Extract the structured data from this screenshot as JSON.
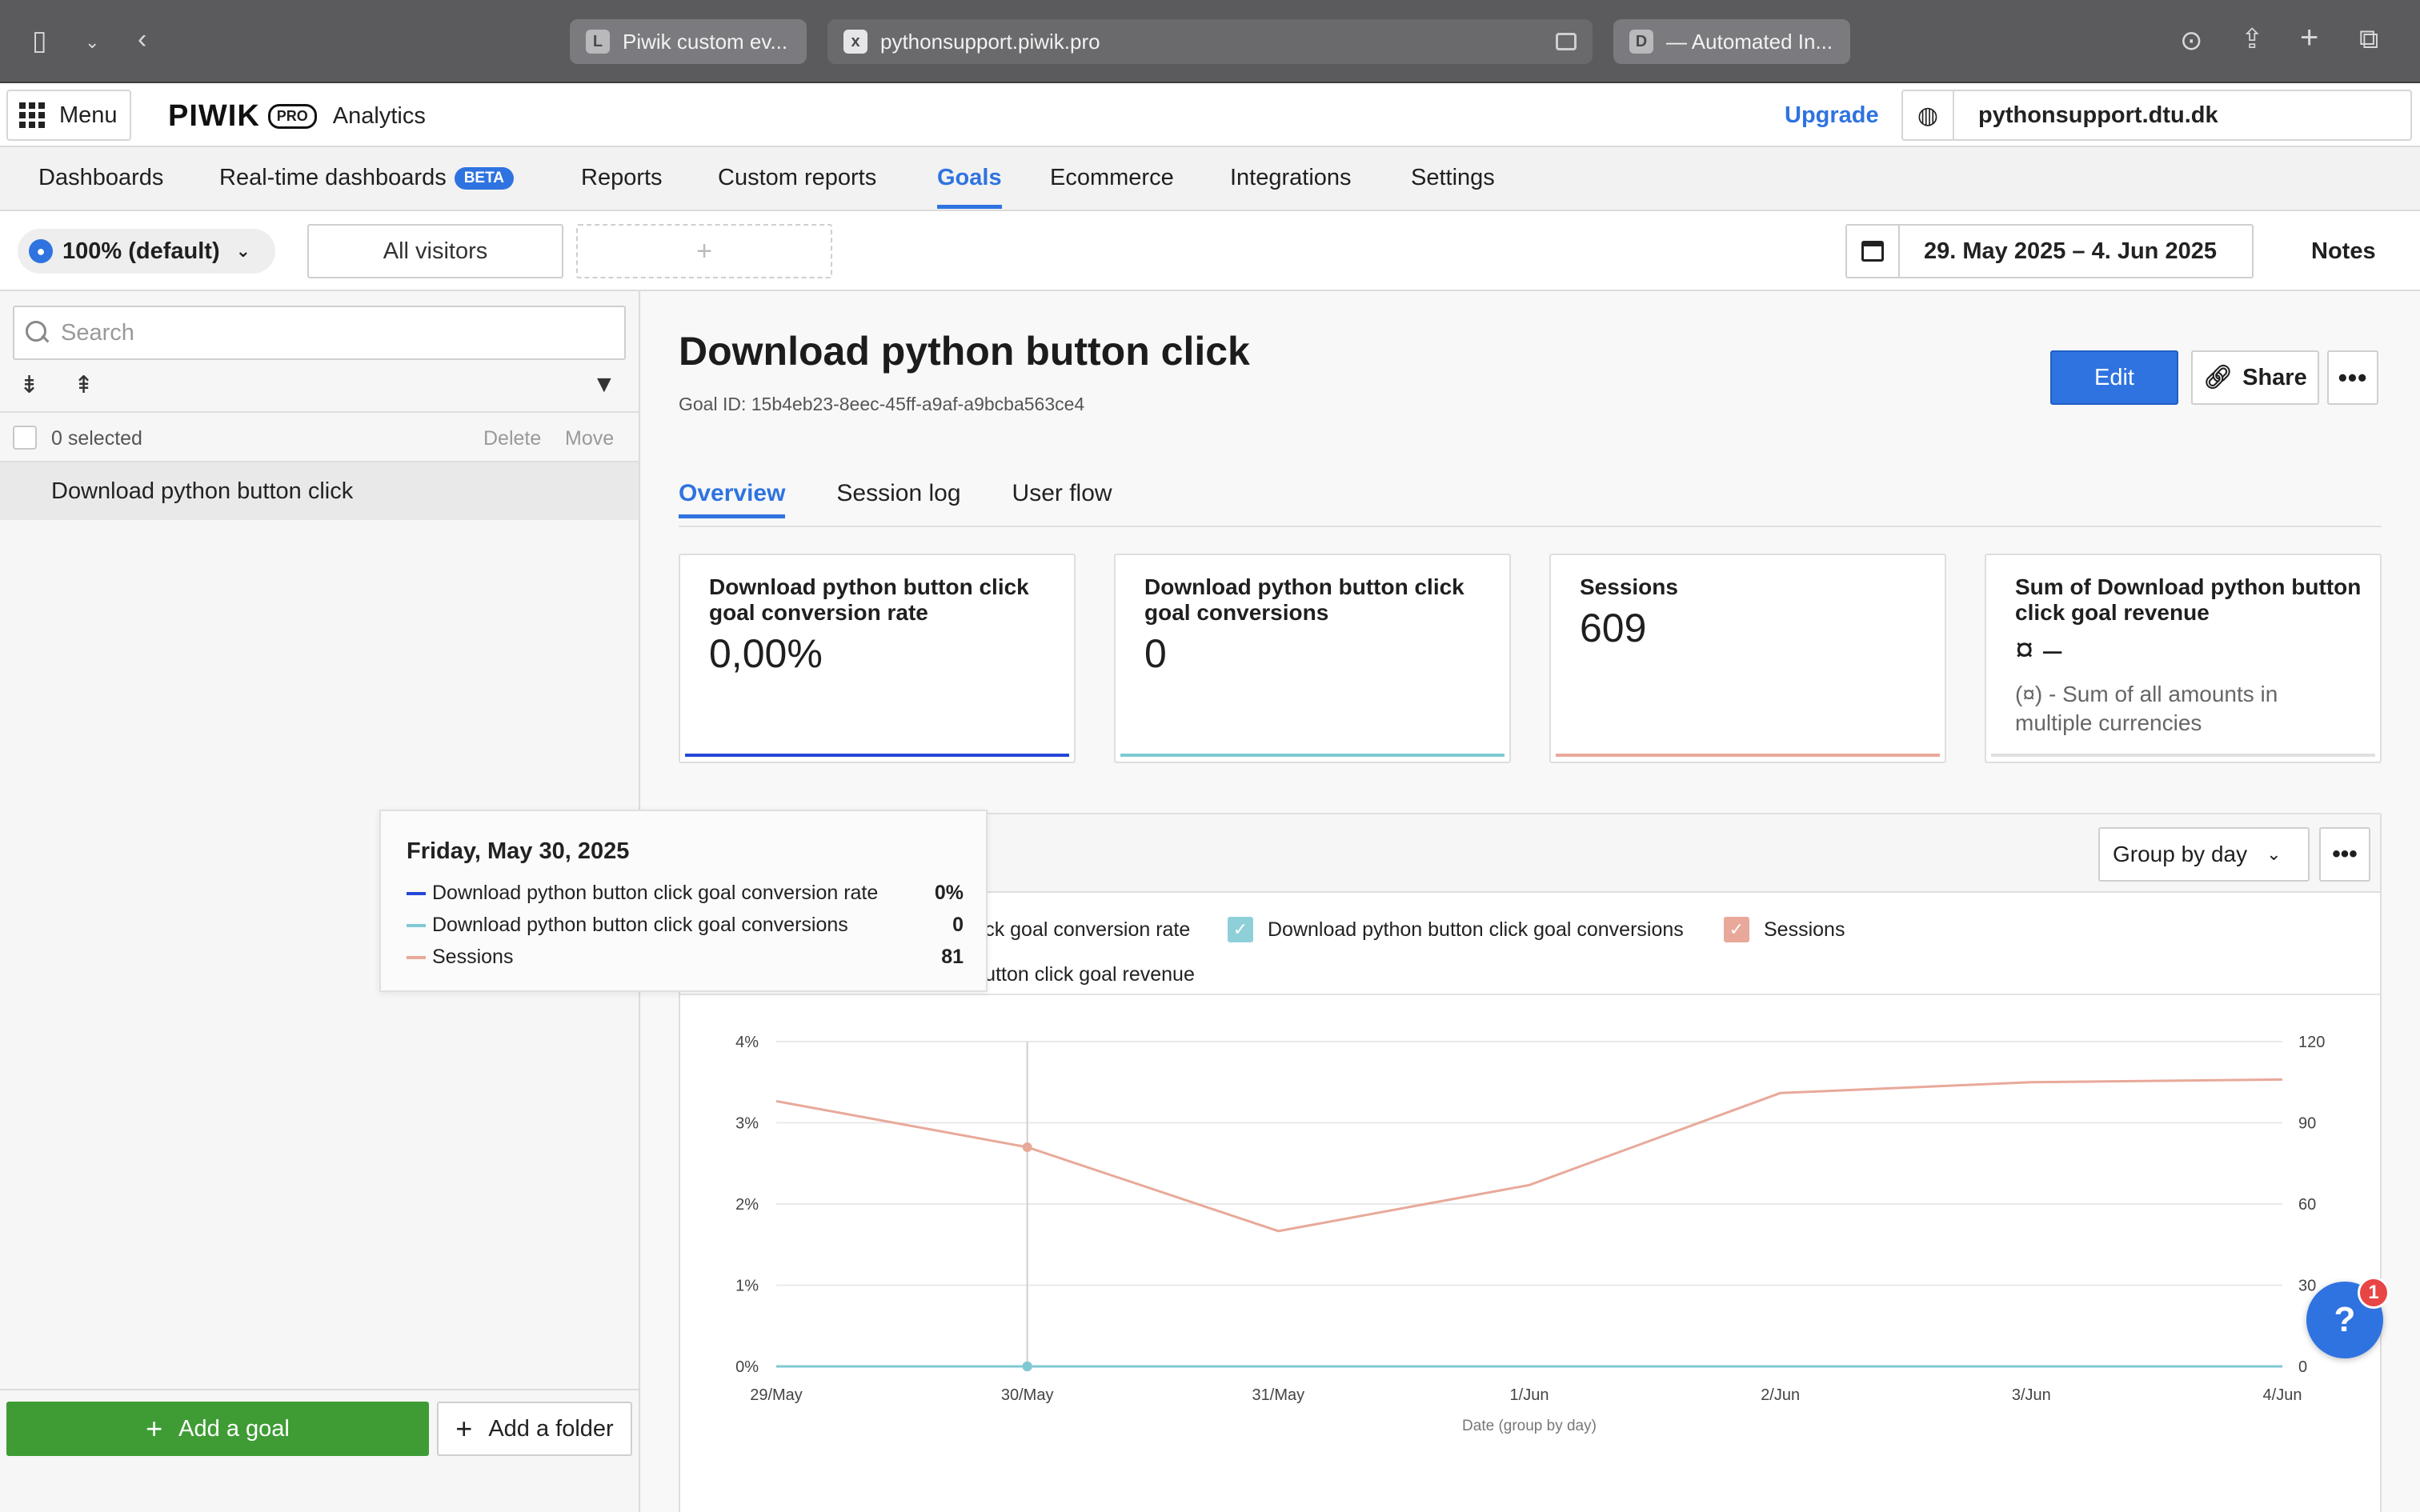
{
  "browser": {
    "tabs": [
      {
        "favicon": "L",
        "title": "Piwik custom ev..."
      },
      {
        "favicon": "x",
        "title": "pythonsupport.piwik.pro"
      },
      {
        "favicon": "D",
        "title": "— Automated In..."
      }
    ],
    "icons": [
      "sidebar-icon",
      "chevron-down-icon",
      "back-icon",
      "download-icon",
      "share-icon",
      "new-tab-icon",
      "tab-overview-icon"
    ]
  },
  "header": {
    "menu_label": "Menu",
    "logo_text": "PIWIK",
    "logo_badge": "PRO",
    "product": "Analytics",
    "upgrade_label": "Upgrade",
    "site": "pythonsupport.dtu.dk"
  },
  "nav": {
    "items": [
      {
        "label": "Dashboards"
      },
      {
        "label": "Real-time dashboards",
        "badge": "BETA"
      },
      {
        "label": "Reports"
      },
      {
        "label": "Custom reports"
      },
      {
        "label": "Goals",
        "active": true
      },
      {
        "label": "Ecommerce"
      },
      {
        "label": "Integrations"
      },
      {
        "label": "Settings"
      }
    ]
  },
  "filters": {
    "sampling": "100% (default)",
    "segment": "All visitors",
    "add_segment": "+",
    "date_range": "29. May 2025 – 4. Jun 2025",
    "notes_label": "Notes"
  },
  "sidebar": {
    "search_placeholder": "Search",
    "selected_text": "0 selected",
    "delete_label": "Delete",
    "move_label": "Move",
    "goals": [
      "Download python button click"
    ],
    "add_goal_label": "Add a goal",
    "add_folder_label": "Add a folder"
  },
  "goal": {
    "title": "Download python button click",
    "id_text": "Goal ID: 15b4eb23-8eec-45ff-a9af-a9bcba563ce4",
    "edit_label": "Edit",
    "share_label": "Share",
    "more_label": "•••",
    "tabs": [
      {
        "label": "Overview",
        "active": true
      },
      {
        "label": "Session log"
      },
      {
        "label": "User flow"
      }
    ]
  },
  "kpis": [
    {
      "label": "Download python button click goal conversion rate",
      "value": "0,00%",
      "color": "#2546d6"
    },
    {
      "label": "Download python button click goal conversions",
      "value": "0",
      "color": "#7fc9d3"
    },
    {
      "label": "Sessions",
      "value": "609",
      "color": "#e8a99a"
    },
    {
      "label": "Sum of Download python button click goal revenue",
      "value": "¤ –",
      "note": "(¤) - Sum of all amounts in multiple currencies",
      "color": "#e0e0e0"
    }
  ],
  "chart_panel": {
    "group_by_label": "Group by day",
    "more_label": "•••",
    "legend": [
      {
        "label": "Download python button click goal conversion rate",
        "checked": true,
        "color": "#2546d6"
      },
      {
        "label": "Download python button click goal conversions",
        "checked": true,
        "color": "#8fd0d8"
      },
      {
        "label": "Sessions",
        "checked": true,
        "color": "#e8a99a"
      },
      {
        "label": "Sum of Download python button click goal revenue",
        "checked": false,
        "color": "#ffffff"
      }
    ]
  },
  "tooltip": {
    "title": "Friday, May 30, 2025",
    "rows": [
      {
        "label": "Download python button click goal conversion rate",
        "value": "0%",
        "color": "#2546d6"
      },
      {
        "label": "Download python button click goal conversions",
        "value": "0",
        "color": "#7fc9d3"
      },
      {
        "label": "Sessions",
        "value": "81",
        "color": "#e8a99a"
      }
    ]
  },
  "help": {
    "label": "?",
    "badge": "1"
  },
  "chart_data": {
    "type": "line",
    "categories": [
      "29/May",
      "30/May",
      "31/May",
      "1/Jun",
      "2/Jun",
      "3/Jun",
      "4/Jun"
    ],
    "xlabel": "Date (group by day)",
    "y_left": {
      "ticks": [
        "0%",
        "1%",
        "2%",
        "3%",
        "4%"
      ],
      "lim": [
        0,
        4
      ]
    },
    "y_right": {
      "ticks": [
        "0",
        "30",
        "60",
        "90",
        "120"
      ],
      "lim": [
        0,
        120
      ]
    },
    "series": [
      {
        "name": "Download python button click goal conversion rate",
        "axis": "left",
        "color": "#2546d6",
        "values": [
          0,
          0,
          0,
          0,
          0,
          0,
          0
        ]
      },
      {
        "name": "Download python button click goal conversions",
        "axis": "right",
        "color": "#7fc9d3",
        "values": [
          0,
          0,
          0,
          0,
          0,
          0,
          0
        ]
      },
      {
        "name": "Sessions",
        "axis": "right",
        "color": "#e8a99a",
        "values": [
          98,
          81,
          50,
          67,
          101,
          105,
          106
        ]
      }
    ],
    "hover_index": 1,
    "grid": true
  }
}
